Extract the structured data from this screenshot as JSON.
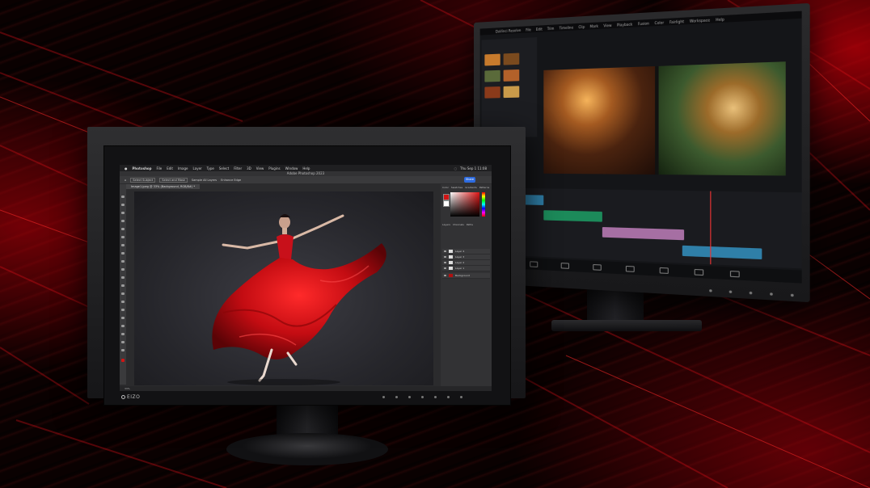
{
  "scene": {
    "accent_color": "#d0101a",
    "background_color": "#0a0101"
  },
  "photo_editor": {
    "menubar": {
      "app": "Photoshop",
      "items": [
        "File",
        "Edit",
        "Image",
        "Layer",
        "Type",
        "Select",
        "Filter",
        "3D",
        "View",
        "Plugins",
        "Window",
        "Help"
      ],
      "clock": "Thu Sep 1  11:08"
    },
    "window_title": "Adobe Photoshop 2023",
    "options_bar": {
      "items": [
        "Select Subject",
        "Select and Mask",
        "Sample All Layers",
        "Enhance Edge"
      ]
    },
    "share_label": "Share",
    "document_tab": "Image1.jpeg @ 33% (Background, RGB/8#) *",
    "panels": {
      "color_tabs": [
        "Color",
        "Swatches",
        "Gradients",
        "Patterns"
      ],
      "layer_tabs": [
        "Layers",
        "Channels",
        "Paths"
      ],
      "layers": [
        "Layer 4",
        "Layer 3",
        "Layer 2",
        "Layer 1",
        "Background"
      ]
    },
    "status_text": "33%",
    "monitor_brand": "EIZO"
  },
  "video_editor": {
    "menubar_items": [
      "DaVinci Resolve",
      "File",
      "Edit",
      "Trim",
      "Timeline",
      "Clip",
      "Mark",
      "View",
      "Playback",
      "Fusion",
      "Color",
      "Fairlight",
      "Workspace",
      "Help"
    ],
    "timeline_clips": [
      {
        "color": "#2f7fa8"
      },
      {
        "color": "#1c8a5a"
      },
      {
        "color": "#a66fa3"
      },
      {
        "color": "#2f7fa8"
      }
    ],
    "page_icons": [
      "media-icon",
      "cut-icon",
      "edit-icon",
      "fusion-icon",
      "color-icon",
      "fairlight-icon",
      "deliver-icon"
    ]
  }
}
